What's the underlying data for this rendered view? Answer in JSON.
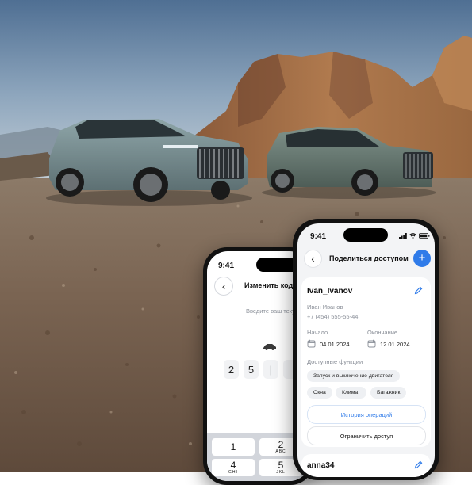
{
  "colors": {
    "accent": "#2f7be9",
    "sky_top": "#6a88a8",
    "ground": "#7a6552"
  },
  "back_phone": {
    "time": "9:41",
    "title": "Изменить код д",
    "prompt": "Введите ваш теку",
    "digits": [
      "2",
      "5",
      "|"
    ],
    "keys": [
      {
        "num": "1",
        "letters": ""
      },
      {
        "num": "2",
        "letters": "ABC"
      },
      {
        "num": "4",
        "letters": "GHI"
      },
      {
        "num": "5",
        "letters": "JKL"
      }
    ]
  },
  "front_phone": {
    "time": "9:41",
    "title": "Поделиться доступом",
    "add_icon": "+",
    "user1": {
      "username": "Ivan_Ivanov",
      "full_name": "Иван Иванов",
      "phone": "+7 (454) 555-55-44",
      "start_label": "Начало",
      "start_date": "04.01.2024",
      "end_label": "Окончание",
      "end_date": "12.01.2024",
      "functions_label": "Доступные функции",
      "functions": [
        "Запуск и выключение двигателя",
        "Окна",
        "Климат",
        "Багажник"
      ],
      "history_button": "История операций",
      "restrict_button": "Ограничить доступ"
    },
    "user2": {
      "username": "anna34"
    }
  }
}
